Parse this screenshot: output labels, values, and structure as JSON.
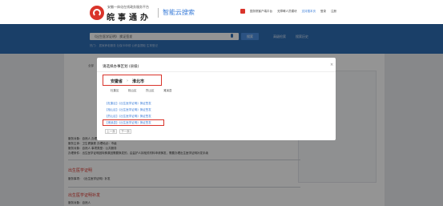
{
  "header": {
    "subtitle": "安徽一体化在线政务服务平台",
    "title": "皖事通办",
    "cloud_title": "智能云搜索",
    "links": [
      "国务院客户端平台",
      "无障碍人员模块",
      "支持搜本页",
      "登录",
      "注册"
    ]
  },
  "search": {
    "value": "《出生医学证明》 换证签发",
    "button_label": "搜索",
    "advanced_label": "高级检索",
    "history_label": "搜索历史",
    "hot_words": "热门：  居家养老服务  社保卡申领  公积金提取  生育登记"
  },
  "content_tabs": [
    "全部",
    "政策文件",
    "办事服务",
    "互动交流",
    "政务动态",
    "数据资源",
    "图片",
    "视频"
  ],
  "background_rows": [
    "服务对象：自然人      办理形式：网上办理",
    "服务主体：卫生健康委    办理地点：市级",
    "服务对象：自然人      事项类型：公共服务",
    "办理条件：出生医学证明因特殊原因需要换发的，由监护人持相关材料申请换发，需要办理出生医学证明补发手续"
  ],
  "background_links": [
    "出生医学证明",
    "出生医学证明补发"
  ],
  "background_notes": [
    "服务事项：《出生医学证明》补发",
    "服务对象：自然人"
  ],
  "modal": {
    "title": "请选择办事区划 (县级)",
    "close": "×",
    "breadcrumb": [
      "安徽省",
      "›",
      "淮北市"
    ],
    "district_tabs": [
      "杜集区",
      "相山区",
      "烈山区",
      "濉溪县"
    ],
    "results": [
      "【杜集区】《出生医学证明》换证签发",
      "【相山区】《出生医学证明》换证签发",
      "【烈山区】《出生医学证明》换证签发",
      "【濉溪县】《出生医学证明》换证签发"
    ],
    "pager": [
      "上一页",
      "下一页"
    ]
  },
  "colors": {
    "brand_red": "#d9342b",
    "brand_blue": "#2e6db4",
    "link_blue": "#3b7dd8"
  }
}
